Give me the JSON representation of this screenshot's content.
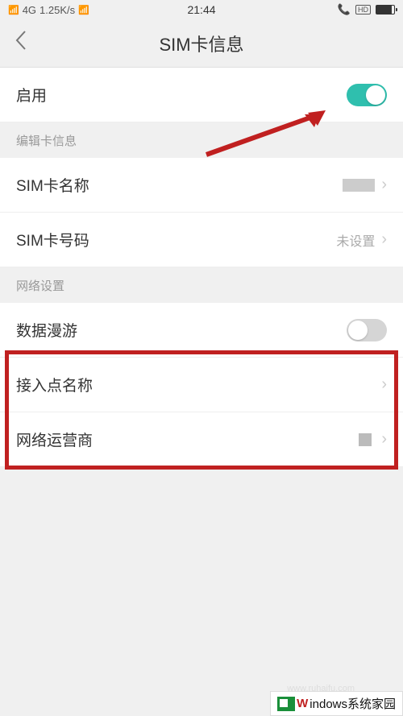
{
  "statusBar": {
    "network": "4G",
    "speed": "1.25K/s",
    "time": "21:44",
    "hd": "HD"
  },
  "header": {
    "title": "SIM卡信息"
  },
  "enableRow": {
    "label": "启用",
    "toggle": true
  },
  "section1": {
    "header": "编辑卡信息",
    "items": [
      {
        "label": "SIM卡名称",
        "value": ""
      },
      {
        "label": "SIM卡号码",
        "value": "未设置"
      }
    ]
  },
  "section2": {
    "header": "网络设置",
    "items": [
      {
        "label": "数据漫游",
        "toggle": false
      },
      {
        "label": "接入点名称"
      },
      {
        "label": "网络运营商"
      }
    ]
  },
  "watermark": {
    "brand_w": "W",
    "brand_rest": "indows系统家园",
    "url": "www.ruhaifu.com"
  }
}
